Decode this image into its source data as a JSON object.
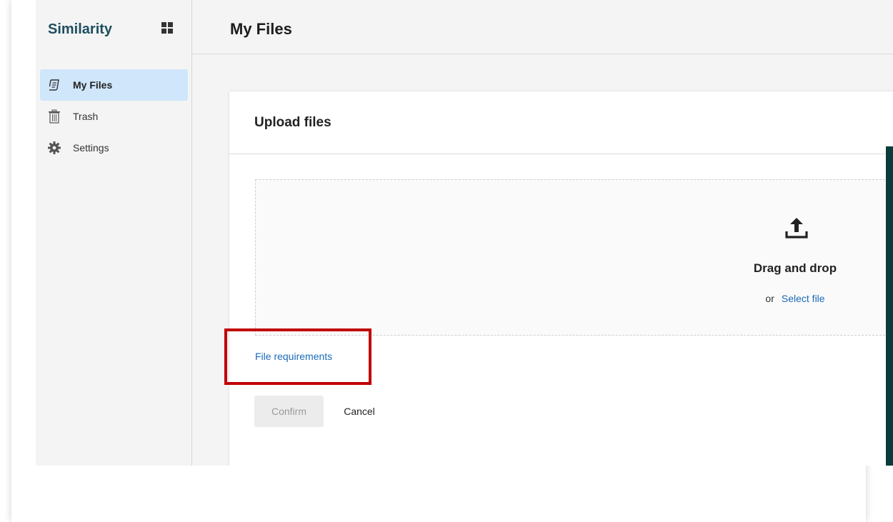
{
  "sidebar": {
    "brand": "Similarity",
    "items": [
      {
        "label": "My Files",
        "icon": "file-list-icon",
        "active": true
      },
      {
        "label": "Trash",
        "icon": "trash-icon",
        "active": false
      },
      {
        "label": "Settings",
        "icon": "gear-icon",
        "active": false
      }
    ]
  },
  "header": {
    "title": "My Files"
  },
  "upload": {
    "title": "Upload files",
    "drop_title": "Drag and drop",
    "or_text": "or",
    "select_link": "Select file",
    "requirements_link": "File requirements",
    "confirm_label": "Confirm",
    "cancel_label": "Cancel"
  },
  "colors": {
    "brand": "#1e4e5f",
    "link": "#1a6ab8",
    "active_nav": "#cfe6fb",
    "highlight": "#c00000",
    "right_strip": "#0b3b3a"
  }
}
